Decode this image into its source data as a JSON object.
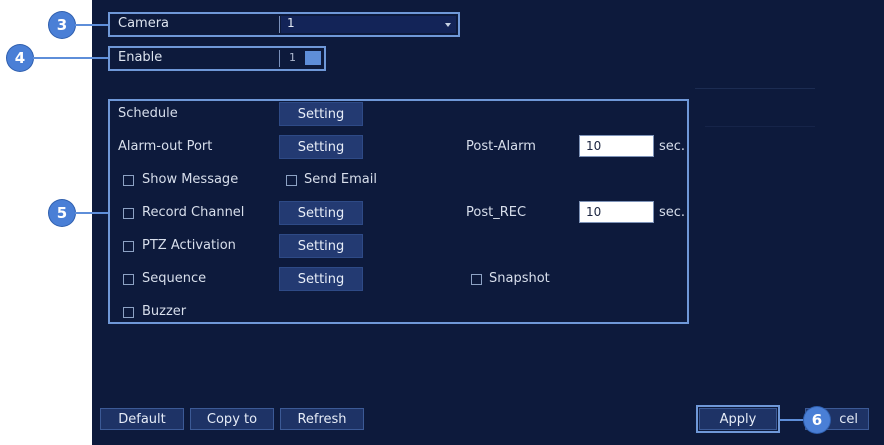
{
  "camera": {
    "label": "Camera",
    "value": "1"
  },
  "enable": {
    "label": "Enable",
    "value": "1"
  },
  "rows": {
    "schedule": {
      "label": "Schedule",
      "button": "Setting"
    },
    "alarm_out_port": {
      "label": "Alarm-out Port",
      "button": "Setting"
    },
    "post_alarm": {
      "label": "Post-Alarm",
      "value": "10",
      "unit": "sec."
    },
    "show_message": {
      "label": "Show Message"
    },
    "send_email": {
      "label": "Send Email"
    },
    "record_channel": {
      "label": "Record Channel",
      "button": "Setting"
    },
    "post_rec": {
      "label": "Post_REC",
      "value": "10",
      "unit": "sec."
    },
    "ptz_activation": {
      "label": "PTZ Activation",
      "button": "Setting"
    },
    "sequence": {
      "label": "Sequence",
      "button": "Setting"
    },
    "snapshot": {
      "label": "Snapshot"
    },
    "buzzer": {
      "label": "Buzzer"
    }
  },
  "footer": {
    "default": "Default",
    "copy_to": "Copy to",
    "refresh": "Refresh",
    "apply": "Apply",
    "cancel_partial": "cel"
  },
  "callouts": [
    "3",
    "4",
    "5",
    "6"
  ],
  "colors": {
    "panel_bg": "#0d1a3c",
    "callout": "#4a7fd6",
    "frame": "#6f98d8",
    "button": "#233a72"
  }
}
